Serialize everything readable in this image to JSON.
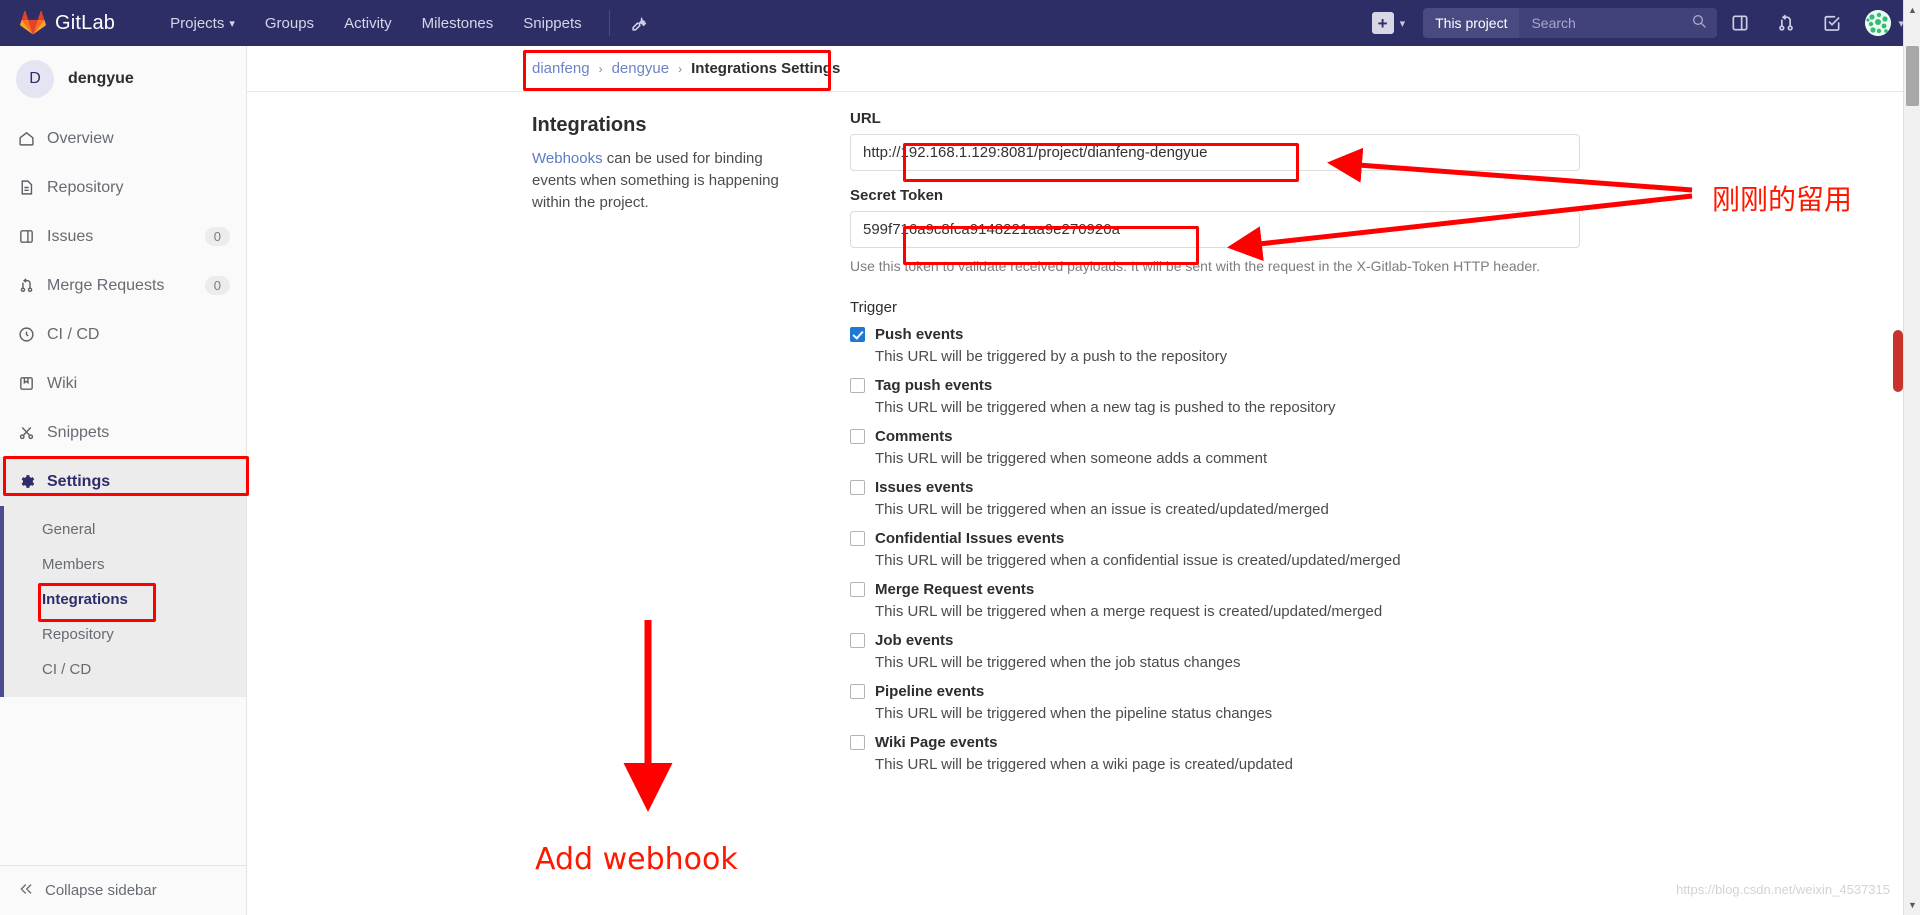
{
  "topnav": {
    "brand": "GitLab",
    "logo_icon": "gitlab-logo-icon",
    "links": [
      {
        "label": "Projects",
        "has_caret": true
      },
      {
        "label": "Groups",
        "has_caret": false
      },
      {
        "label": "Activity",
        "has_caret": false
      },
      {
        "label": "Milestones",
        "has_caret": false
      },
      {
        "label": "Snippets",
        "has_caret": false
      }
    ],
    "wrench_icon": "wrench-icon",
    "plus_icon": "plus-icon",
    "plus_caret": "chevron-down-icon",
    "search_scope": "This project",
    "search_placeholder": "Search",
    "search_icon": "search-icon",
    "issues_icon": "issues-board-icon",
    "merge_icon": "merge-request-icon",
    "todos_icon": "todos-done-icon",
    "avatar": "user-avatar",
    "avatar_caret": "chevron-down-icon"
  },
  "sidebar": {
    "avatar_initial": "D",
    "project_name": "dengyue",
    "items": [
      {
        "label": "Overview",
        "icon": "home-icon",
        "badge": ""
      },
      {
        "label": "Repository",
        "icon": "document-icon",
        "badge": ""
      },
      {
        "label": "Issues",
        "icon": "issues-icon",
        "badge": "0"
      },
      {
        "label": "Merge Requests",
        "icon": "merge-request-icon",
        "badge": "0"
      },
      {
        "label": "CI / CD",
        "icon": "rocket-icon",
        "badge": ""
      },
      {
        "label": "Wiki",
        "icon": "book-icon",
        "badge": ""
      },
      {
        "label": "Snippets",
        "icon": "scissors-icon",
        "badge": ""
      },
      {
        "label": "Settings",
        "icon": "gear-icon",
        "badge": ""
      }
    ],
    "sub_items": [
      {
        "label": "General"
      },
      {
        "label": "Members"
      },
      {
        "label": "Integrations"
      },
      {
        "label": "Repository"
      },
      {
        "label": "CI / CD"
      }
    ],
    "collapse_label": "Collapse sidebar",
    "collapse_icon": "double-chevron-left-icon"
  },
  "breadcrumb": {
    "group": "dianfeng",
    "project": "dengyue",
    "current": "Integrations Settings",
    "separator": "›"
  },
  "page": {
    "heading": "Integrations",
    "description_link": "Webhooks",
    "description_rest": " can be used for binding events when something is happening within the project.",
    "url_label": "URL",
    "url_value": "http://192.168.1.129:8081/project/dianfeng-dengyue",
    "token_label": "Secret Token",
    "token_value": "599f716a9c8fca9148221aa9e270920a",
    "token_help": "Use this token to validate received payloads. It will be sent with the request in the X-Gitlab-Token HTTP header.",
    "trigger_title": "Trigger",
    "triggers": [
      {
        "label": "Push events",
        "desc": "This URL will be triggered by a push to the repository",
        "checked": true
      },
      {
        "label": "Tag push events",
        "desc": "This URL will be triggered when a new tag is pushed to the repository",
        "checked": false
      },
      {
        "label": "Comments",
        "desc": "This URL will be triggered when someone adds a comment",
        "checked": false
      },
      {
        "label": "Issues events",
        "desc": "This URL will be triggered when an issue is created/updated/merged",
        "checked": false
      },
      {
        "label": "Confidential Issues events",
        "desc": "This URL will be triggered when a confidential issue is created/updated/merged",
        "checked": false
      },
      {
        "label": "Merge Request events",
        "desc": "This URL will be triggered when a merge request is created/updated/merged",
        "checked": false
      },
      {
        "label": "Job events",
        "desc": "This URL will be triggered when the job status changes",
        "checked": false
      },
      {
        "label": "Pipeline events",
        "desc": "This URL will be triggered when the pipeline status changes",
        "checked": false
      },
      {
        "label": "Wiki Page events",
        "desc": "This URL will be triggered when a wiki page is created/updated",
        "checked": false
      }
    ]
  },
  "annotations": {
    "note_cn": "刚刚的留用",
    "note_en": "Add webhook",
    "accent_color": "#fe0000"
  },
  "watermark": "https://blog.csdn.net/weixin_4537315",
  "scrollbar": {
    "up_arrow": "triangle-up-icon",
    "down_arrow": "triangle-down-icon"
  }
}
